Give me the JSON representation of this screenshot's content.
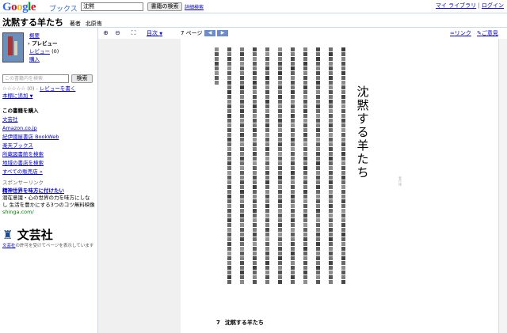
{
  "header": {
    "logo_letters": [
      {
        "ch": "G",
        "color": "#3369e8"
      },
      {
        "ch": "o",
        "color": "#d50f25"
      },
      {
        "ch": "o",
        "color": "#eeb211"
      },
      {
        "ch": "g",
        "color": "#3369e8"
      },
      {
        "ch": "l",
        "color": "#009925"
      },
      {
        "ch": "e",
        "color": "#d50f25"
      }
    ],
    "product": "ブックス",
    "search_value": "沈黙",
    "search_button": "書籍の検索",
    "advanced_link": "詳細検索",
    "my_library": "マイ ライブラリ",
    "separator": "|",
    "login": "ログイン"
  },
  "book": {
    "title": "沈黙する羊たち",
    "author_label": "著者",
    "author": "北原侑"
  },
  "sidebar": {
    "overview": "概要",
    "preview": "› プレビュー",
    "reviews": "レビュー",
    "reviews_count": "(0)",
    "buy": "購入",
    "search_placeholder": "この書籍内を検索",
    "search_button": "検索",
    "rating": "☆☆☆☆☆ (0) -",
    "write_review": "レビューを書く",
    "add_to_shelf": "本棚に追加",
    "buy_heading": "この書籍を購入",
    "stores": [
      "文芸社",
      "Amazon.co.jp",
      "紀伊國屋書店 BookWeb",
      "楽天ブックス",
      "所蔵図書館を検索",
      "地域の書店を検索",
      "すべての販売店 »"
    ],
    "sponsor_label": "スポンサーリンク",
    "ad_title": "精神世界を味方に付けたい",
    "ad_line1": "潜在意識・心の世界の力を味方にしな",
    "ad_line2": "し 生活を豊かにする3つのコツ無料映像",
    "ad_url": "shinga.com/",
    "publisher_logo": "文芸社",
    "permission_link": "文芸社",
    "permission_text": "の許可を受けてページを表示しています"
  },
  "toolbar": {
    "zoom_in": "zoom-in",
    "zoom_out": "zoom-out",
    "fullscreen": "fullscreen",
    "toc": "目次",
    "page_label": "7 ページ",
    "prev": "◀",
    "next": "▶",
    "link": "リンク",
    "feedback": "ご意見"
  },
  "page": {
    "vertical_title": "沈黙する羊たち",
    "footer_number": "7",
    "footer_title": "沈黙する羊たち",
    "side_mark": "著作権"
  }
}
